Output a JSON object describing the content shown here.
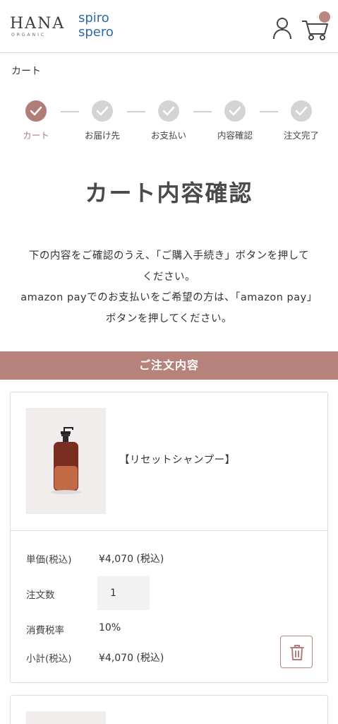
{
  "header": {
    "logo_hana": "HANA",
    "logo_hana_sub": "ORGANIC",
    "logo_spiro_line1": "spiro",
    "logo_spiro_line2": "spero",
    "user_icon": "user-icon",
    "cart_icon": "cart-icon"
  },
  "breadcrumb": "カート",
  "steps": [
    {
      "label": "カート",
      "state": "active"
    },
    {
      "label": "お届け先",
      "state": "inactive"
    },
    {
      "label": "お支払い",
      "state": "inactive"
    },
    {
      "label": "内容確認",
      "state": "inactive"
    },
    {
      "label": "注文完了",
      "state": "inactive"
    }
  ],
  "page_title": "カート内容確認",
  "intro": {
    "line1": "下の内容をご確認のうえ、「ご購入手続き」ボタンを押して",
    "line2": "ください。",
    "line3": "amazon payでのお支払いをご希望の方は、「amazon pay」",
    "line4": "ボタンを押してください。"
  },
  "order_band": "ご注文内容",
  "cart_items": [
    {
      "name": "【リセットシャンプー】",
      "unit_price_label": "単価(税込)",
      "unit_price": "¥4,070 (税込)",
      "quantity_label": "注文数",
      "quantity": "1",
      "tax_rate_label": "消費税率",
      "tax_rate": "10%",
      "subtotal_label": "小計(税込)",
      "subtotal": "¥4,070 (税込)"
    }
  ],
  "colors": {
    "accent": "#b7827c",
    "step_active": "#b07d78",
    "step_inactive": "#d4d4d4",
    "brand_blue": "#2e6aa7"
  }
}
